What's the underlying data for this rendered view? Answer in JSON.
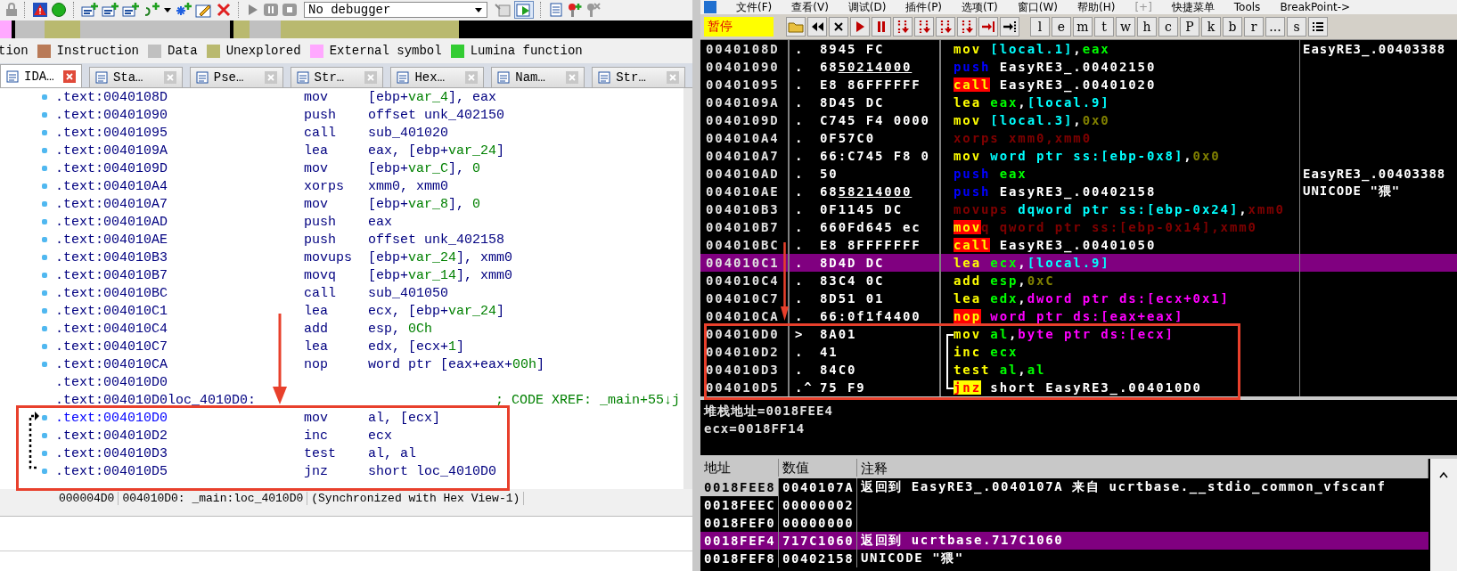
{
  "ida": {
    "debugger": "No debugger",
    "legend": [
      {
        "label": "tion"
      },
      {
        "label": "Instruction",
        "color": "#b97a57"
      },
      {
        "label": "Data",
        "color": "#c0c0c0"
      },
      {
        "label": "Unexplored",
        "color": "#b9b96f"
      },
      {
        "label": "External symbol",
        "color": "#ffa8ff"
      },
      {
        "label": "Lumina function",
        "color": "#33cc33"
      }
    ],
    "tabs": [
      {
        "label": "IDA…",
        "selected": true
      },
      {
        "label": "Sta…",
        "selected": false
      },
      {
        "label": "Pse…",
        "selected": false
      },
      {
        "label": "Str…",
        "selected": false
      },
      {
        "label": "Hex…",
        "selected": false
      },
      {
        "label": "Nam…",
        "selected": false
      },
      {
        "label": "Str…",
        "selected": false
      }
    ],
    "rows": [
      {
        "address": ".text:0040108D",
        "dot": true,
        "selected": false,
        "mnemonic": "mov",
        "operands": [
          {
            "t": "[ebp+"
          },
          {
            "t": "var_4",
            "highlighted": true
          },
          {
            "t": "], eax"
          }
        ]
      },
      {
        "address": ".text:00401090",
        "dot": true,
        "selected": false,
        "mnemonic": "push",
        "operands": [
          {
            "t": "offset unk_402150"
          }
        ]
      },
      {
        "address": ".text:00401095",
        "dot": true,
        "selected": false,
        "mnemonic": "call",
        "operands": [
          {
            "t": "sub_401020"
          }
        ]
      },
      {
        "address": ".text:0040109A",
        "dot": true,
        "selected": false,
        "mnemonic": "lea",
        "operands": [
          {
            "t": "eax, [ebp+"
          },
          {
            "t": "var_24",
            "highlighted": true
          },
          {
            "t": "]"
          }
        ]
      },
      {
        "address": ".text:0040109D",
        "dot": true,
        "selected": false,
        "mnemonic": "mov",
        "operands": [
          {
            "t": "[ebp+"
          },
          {
            "t": "var_C",
            "highlighted": true
          },
          {
            "t": "], "
          },
          {
            "t": "0",
            "highlighted": true
          }
        ]
      },
      {
        "address": ".text:004010A4",
        "dot": true,
        "selected": false,
        "mnemonic": "xorps",
        "operands": [
          {
            "t": "xmm0, xmm0"
          }
        ]
      },
      {
        "address": ".text:004010A7",
        "dot": true,
        "selected": false,
        "mnemonic": "mov",
        "operands": [
          {
            "t": "[ebp+"
          },
          {
            "t": "var_8",
            "highlighted": true
          },
          {
            "t": "], "
          },
          {
            "t": "0",
            "highlighted": true
          }
        ]
      },
      {
        "address": ".text:004010AD",
        "dot": true,
        "selected": false,
        "mnemonic": "push",
        "operands": [
          {
            "t": "eax"
          }
        ]
      },
      {
        "address": ".text:004010AE",
        "dot": true,
        "selected": false,
        "mnemonic": "push",
        "operands": [
          {
            "t": "offset unk_402158"
          }
        ]
      },
      {
        "address": ".text:004010B3",
        "dot": true,
        "selected": false,
        "mnemonic": "movups",
        "operands": [
          {
            "t": "[ebp+"
          },
          {
            "t": "var_24",
            "highlighted": true
          },
          {
            "t": "], xmm0"
          }
        ]
      },
      {
        "address": ".text:004010B7",
        "dot": true,
        "selected": false,
        "mnemonic": "movq",
        "operands": [
          {
            "t": "[ebp+"
          },
          {
            "t": "var_14",
            "highlighted": true
          },
          {
            "t": "], xmm0"
          }
        ]
      },
      {
        "address": ".text:004010BC",
        "dot": true,
        "selected": false,
        "mnemonic": "call",
        "operands": [
          {
            "t": "sub_401050"
          }
        ]
      },
      {
        "address": ".text:004010C1",
        "dot": true,
        "selected": false,
        "mnemonic": "lea",
        "operands": [
          {
            "t": "ecx, [ebp+"
          },
          {
            "t": "var_24",
            "highlighted": true
          },
          {
            "t": "]"
          }
        ]
      },
      {
        "address": ".text:004010C4",
        "dot": true,
        "selected": false,
        "mnemonic": "add",
        "operands": [
          {
            "t": "esp, "
          },
          {
            "t": "0Ch",
            "highlighted": true
          }
        ]
      },
      {
        "address": ".text:004010C7",
        "dot": true,
        "selected": false,
        "mnemonic": "lea",
        "operands": [
          {
            "t": "edx, [ecx+"
          },
          {
            "t": "1",
            "highlighted": true
          },
          {
            "t": "]"
          }
        ]
      },
      {
        "address": ".text:004010CA",
        "dot": true,
        "selected": false,
        "mnemonic": "nop",
        "operands": [
          {
            "t": "word ptr [eax+eax+"
          },
          {
            "t": "00h",
            "highlighted": true
          },
          {
            "t": "]"
          }
        ]
      },
      {
        "address": ".text:004010D0",
        "dot": false,
        "selected": false
      },
      {
        "address": ".text:004010D0",
        "dot": false,
        "selected": false,
        "label": "loc_4010D0:",
        "comment": "; CODE XREF: _main+55↓j"
      },
      {
        "address": ".text:004010D0",
        "dot": true,
        "selected": true,
        "mnemonic": "mov",
        "operands": [
          {
            "t": "al, [ecx]"
          }
        ]
      },
      {
        "address": ".text:004010D2",
        "dot": true,
        "selected": false,
        "mnemonic": "inc",
        "operands": [
          {
            "t": "ecx"
          }
        ]
      },
      {
        "address": ".text:004010D3",
        "dot": true,
        "selected": false,
        "mnemonic": "test",
        "operands": [
          {
            "t": "al, al"
          }
        ]
      },
      {
        "address": ".text:004010D5",
        "dot": true,
        "selected": false,
        "mnemonic": "jnz",
        "operands": [
          {
            "t": "short loc_4010D0"
          }
        ]
      }
    ],
    "status": [
      "000004D0",
      "004010D0: _main:loc_4010D0",
      "(Synchronized with Hex View-1)"
    ]
  },
  "olly": {
    "menu": [
      {
        "label": "文件(F)",
        "disabled": false
      },
      {
        "label": "查看(V)",
        "disabled": false
      },
      {
        "label": "调试(D)",
        "disabled": false
      },
      {
        "label": "插件(P)",
        "disabled": false
      },
      {
        "label": "选项(T)",
        "disabled": false
      },
      {
        "label": "窗口(W)",
        "disabled": false
      },
      {
        "label": "帮助(H)",
        "disabled": false
      },
      {
        "label": "[+]",
        "disabled": true
      },
      {
        "label": "快捷菜单",
        "disabled": false
      },
      {
        "label": "Tools",
        "disabled": false
      },
      {
        "label": "BreakPoint->",
        "disabled": false
      }
    ],
    "state": "暂停",
    "letters": [
      "l",
      "e",
      "m",
      "t",
      "w",
      "h",
      "c",
      "P",
      "k",
      "b",
      "r",
      "...",
      "s"
    ],
    "rows": [
      {
        "address": "0040108D",
        "marker": ".",
        "hex": "8945 FC",
        "selected": false,
        "loop": false,
        "mnemonic": [
          {
            "t": "mov",
            "color": "#ffff00"
          }
        ],
        "operands": [
          {
            "t": "[local.1]",
            "color": "#00ffff"
          },
          {
            "t": ",",
            "color": "#ffffff"
          },
          {
            "t": "eax",
            "color": "#00ff00"
          }
        ],
        "comment": "EasyRE3_.00403388"
      },
      {
        "address": "00401090",
        "marker": ".",
        "hex": "68",
        "reloc": "50214000",
        "selected": false,
        "loop": false,
        "mnemonic": [
          {
            "t": "push",
            "color": "#0000ff"
          }
        ],
        "operands": [
          {
            "t": "EasyRE3_.00402150",
            "color": "#ffffff"
          }
        ]
      },
      {
        "address": "00401095",
        "marker": ".",
        "hex": "E8 86FFFFFF",
        "selected": false,
        "loop": false,
        "mnemonic": [
          {
            "t": "call",
            "kind": "alert"
          }
        ],
        "operands": [
          {
            "t": "EasyRE3_.00401020",
            "color": "#ffffff"
          }
        ]
      },
      {
        "address": "0040109A",
        "marker": ".",
        "hex": "8D45 DC",
        "selected": false,
        "loop": false,
        "mnemonic": [
          {
            "t": "lea",
            "color": "#ffff00"
          }
        ],
        "operands": [
          {
            "t": "eax",
            "color": "#00ff00"
          },
          {
            "t": ",",
            "color": "#ffffff"
          },
          {
            "t": "[local.9]",
            "color": "#00ffff"
          }
        ]
      },
      {
        "address": "0040109D",
        "marker": ".",
        "hex": "C745 F4 0000",
        "selected": false,
        "loop": false,
        "mnemonic": [
          {
            "t": "mov",
            "color": "#ffff00"
          }
        ],
        "operands": [
          {
            "t": "[local.3]",
            "color": "#00ffff"
          },
          {
            "t": ",",
            "color": "#ffffff"
          },
          {
            "t": "0x0",
            "color": "#808000"
          }
        ]
      },
      {
        "address": "004010A4",
        "marker": ".",
        "hex": "0F57C0",
        "selected": false,
        "loop": false,
        "mnemonic": [
          {
            "t": "xorps",
            "color": "#800000"
          }
        ],
        "operands": [
          {
            "t": "xmm0,xmm0",
            "color": "#800000"
          }
        ]
      },
      {
        "address": "004010A7",
        "marker": ".",
        "hex": "66:C745 F8 0",
        "selected": false,
        "loop": false,
        "mnemonic": [
          {
            "t": "mov",
            "color": "#ffff00"
          }
        ],
        "operands": [
          {
            "t": "word ptr ss:[ebp-0x8]",
            "color": "#00ffff"
          },
          {
            "t": ",",
            "color": "#ffffff"
          },
          {
            "t": "0x0",
            "color": "#808000"
          }
        ]
      },
      {
        "address": "004010AD",
        "marker": ".",
        "hex": "50",
        "selected": false,
        "loop": false,
        "mnemonic": [
          {
            "t": "push",
            "color": "#0000ff"
          }
        ],
        "operands": [
          {
            "t": "eax",
            "color": "#00ff00"
          }
        ],
        "comment": "EasyRE3_.00403388"
      },
      {
        "address": "004010AE",
        "marker": ".",
        "hex": "68",
        "reloc": "58214000",
        "selected": false,
        "loop": false,
        "mnemonic": [
          {
            "t": "push",
            "color": "#0000ff"
          }
        ],
        "operands": [
          {
            "t": "EasyRE3_.00402158",
            "color": "#ffffff"
          }
        ],
        "comment": "UNICODE \"猥\""
      },
      {
        "address": "004010B3",
        "marker": ".",
        "hex": "0F1145 DC",
        "selected": false,
        "loop": false,
        "mnemonic": [
          {
            "t": "movups",
            "color": "#800000"
          }
        ],
        "operands": [
          {
            "t": "dqword ptr ss:[ebp-0x24]",
            "color": "#00ffff"
          },
          {
            "t": ",",
            "color": "#ffffff"
          },
          {
            "t": "xmm0",
            "color": "#800000"
          }
        ]
      },
      {
        "address": "004010B7",
        "marker": ".",
        "hex": "660Fd645 ec",
        "selected": false,
        "loop": false,
        "mnemonic": [
          {
            "t": "mov",
            "kind": "alert"
          },
          {
            "t": "q",
            "color": "#800000"
          }
        ],
        "operands": [
          {
            "t": "qword ptr ss:[ebp-0x14],xmm0",
            "color": "#800000"
          }
        ]
      },
      {
        "address": "004010BC",
        "marker": ".",
        "hex": "E8 8FFFFFFF",
        "selected": false,
        "loop": false,
        "mnemonic": [
          {
            "t": "call",
            "kind": "alert"
          }
        ],
        "operands": [
          {
            "t": "EasyRE3_.00401050",
            "color": "#ffffff"
          }
        ]
      },
      {
        "address": "004010C1",
        "marker": ".",
        "hex": "8D4D DC",
        "selected": true,
        "loop": false,
        "mnemonic": [
          {
            "t": "lea",
            "color": "#ffff00"
          }
        ],
        "operands": [
          {
            "t": "ecx",
            "color": "#00ff00"
          },
          {
            "t": ",",
            "color": "#ffffff"
          },
          {
            "t": "[local.9]",
            "color": "#00ffff"
          }
        ]
      },
      {
        "address": "004010C4",
        "marker": ".",
        "hex": "83C4 0C",
        "selected": false,
        "loop": false,
        "mnemonic": [
          {
            "t": "add",
            "color": "#ffff00"
          }
        ],
        "operands": [
          {
            "t": "esp",
            "color": "#00ff00"
          },
          {
            "t": ",",
            "color": "#ffffff"
          },
          {
            "t": "0xC",
            "color": "#808000"
          }
        ]
      },
      {
        "address": "004010C7",
        "marker": ".",
        "hex": "8D51 01",
        "selected": false,
        "loop": false,
        "mnemonic": [
          {
            "t": "lea",
            "color": "#ffff00"
          }
        ],
        "operands": [
          {
            "t": "edx",
            "color": "#00ff00"
          },
          {
            "t": ",",
            "color": "#ffffff"
          },
          {
            "t": "dword ptr ds:[ecx+0x1]",
            "color": "#ff00ff"
          }
        ]
      },
      {
        "address": "004010CA",
        "marker": ".",
        "hex": "66:0f1f4400",
        "selected": false,
        "loop": false,
        "mnemonic": [
          {
            "t": "nop",
            "kind": "alert"
          }
        ],
        "operands": [
          {
            "t": "word ptr ds:[eax+eax]",
            "color": "#ff00ff"
          }
        ]
      },
      {
        "address": "004010D0",
        "marker": ">",
        "hex": "8A01",
        "selected": false,
        "loop": true,
        "mnemonic": [
          {
            "t": "mov",
            "color": "#ffff00"
          }
        ],
        "operands": [
          {
            "t": "al",
            "color": "#00ff00"
          },
          {
            "t": ",",
            "color": "#ffffff"
          },
          {
            "t": "byte ptr ds:[ecx]",
            "color": "#ff00ff"
          }
        ]
      },
      {
        "address": "004010D2",
        "marker": ".",
        "hex": "41",
        "selected": false,
        "loop": true,
        "mnemonic": [
          {
            "t": "inc",
            "color": "#ffff00"
          }
        ],
        "operands": [
          {
            "t": "ecx",
            "color": "#00ff00"
          }
        ]
      },
      {
        "address": "004010D3",
        "marker": ".",
        "hex": "84C0",
        "selected": false,
        "loop": true,
        "mnemonic": [
          {
            "t": "test",
            "color": "#ffff00"
          }
        ],
        "operands": [
          {
            "t": "al",
            "color": "#00ff00"
          },
          {
            "t": ",",
            "color": "#ffffff"
          },
          {
            "t": "al",
            "color": "#00ff00"
          }
        ]
      },
      {
        "address": "004010D5",
        "marker": ".^",
        "hex": "75 F9",
        "selected": false,
        "loop": true,
        "mnemonic": [
          {
            "t": "jnz",
            "kind": "jump"
          }
        ],
        "operands": [
          {
            "t": "short EasyRE3_.004010D0",
            "color": "#ffffff"
          }
        ]
      }
    ],
    "info": [
      "堆栈地址=0018FEE4",
      "ecx=0018FF14"
    ],
    "stack_columns": [
      "地址",
      "数值",
      "注释"
    ],
    "stack": [
      {
        "address": "0018FEE8",
        "value": "0040107A",
        "comment": "返回到 EasyRE3_.0040107A 来自 ucrtbase.__stdio_common_vfscanf",
        "current": true,
        "selected": false
      },
      {
        "address": "0018FEEC",
        "value": "00000002",
        "current": false,
        "selected": false
      },
      {
        "address": "0018FEF0",
        "value": "00000000",
        "current": false,
        "selected": false
      },
      {
        "address": "0018FEF4",
        "value": "717C1060",
        "comment": "返回到 ucrtbase.717C1060",
        "current": false,
        "selected": true
      },
      {
        "address": "0018FEF8",
        "value": "00402158",
        "comment": "UNICODE \"猥\"",
        "current": false,
        "selected": false
      }
    ]
  }
}
